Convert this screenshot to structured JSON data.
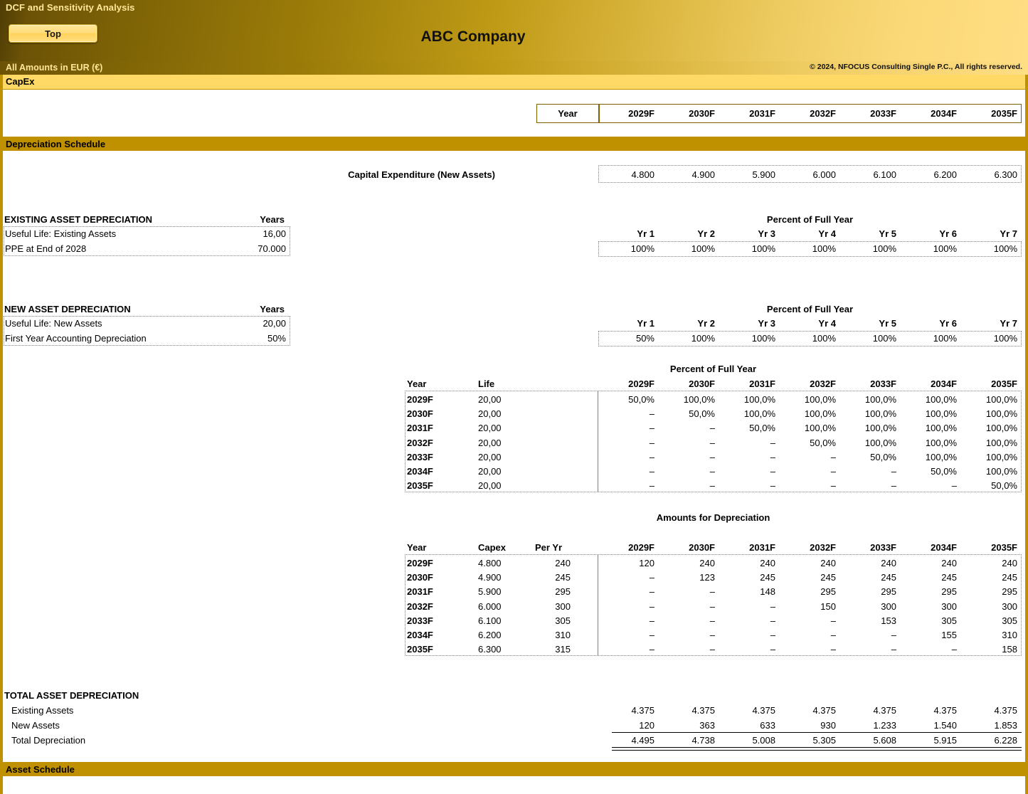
{
  "banner": {
    "title": "DCF and Sensitivity Analysis",
    "top_button": "Top",
    "company": "ABC Company",
    "amounts": "All Amounts in  EUR (€)",
    "copyright": "© 2024, NFOCUS Consulting Single P.C., All rights reserved."
  },
  "sheet_tab": "CapEx",
  "sections": {
    "depreciation_schedule": "Depreciation Schedule",
    "asset_schedule": "Asset Schedule"
  },
  "year_header": {
    "label": "Year",
    "years": [
      "2029F",
      "2030F",
      "2031F",
      "2032F",
      "2033F",
      "2034F",
      "2035F"
    ]
  },
  "capex_row": {
    "label": "Capital Expenditure  (New Assets)",
    "values": [
      "4.800",
      "4.900",
      "5.900",
      "6.000",
      "6.100",
      "6.200",
      "6.300"
    ]
  },
  "existing_asset": {
    "title": "EXISTING ASSET DEPRECIATION",
    "years_header": "Years",
    "rows": [
      {
        "label": "Useful Life: Existing Assets",
        "value": "16,00"
      },
      {
        "label": "PPE at End of 2028",
        "value": "70.000"
      }
    ],
    "percent_title": "Percent of Full Year",
    "yr_headers": [
      "Yr 1",
      "Yr 2",
      "Yr 3",
      "Yr 4",
      "Yr 5",
      "Yr 6",
      "Yr 7"
    ],
    "percents": [
      "100%",
      "100%",
      "100%",
      "100%",
      "100%",
      "100%",
      "100%"
    ]
  },
  "new_asset": {
    "title": "NEW ASSET DEPRECIATION",
    "years_header": "Years",
    "rows": [
      {
        "label": "Useful Life: New Assets",
        "value": "20,00"
      },
      {
        "label": "First Year Accounting Depreciation",
        "value": "50%"
      }
    ],
    "percent_title": "Percent of Full Year",
    "yr_headers": [
      "Yr 1",
      "Yr 2",
      "Yr 3",
      "Yr 4",
      "Yr 5",
      "Yr 6",
      "Yr 7"
    ],
    "percents": [
      "50%",
      "100%",
      "100%",
      "100%",
      "100%",
      "100%",
      "100%"
    ]
  },
  "percent_matrix": {
    "title": "Percent of Full Year",
    "col_year": "Year",
    "col_life": "Life",
    "year_cols": [
      "2029F",
      "2030F",
      "2031F",
      "2032F",
      "2033F",
      "2034F",
      "2035F"
    ],
    "rows": [
      {
        "year": "2029F",
        "life": "20,00",
        "values": [
          "50,0%",
          "100,0%",
          "100,0%",
          "100,0%",
          "100,0%",
          "100,0%",
          "100,0%"
        ]
      },
      {
        "year": "2030F",
        "life": "20,00",
        "values": [
          "–",
          "50,0%",
          "100,0%",
          "100,0%",
          "100,0%",
          "100,0%",
          "100,0%"
        ]
      },
      {
        "year": "2031F",
        "life": "20,00",
        "values": [
          "–",
          "–",
          "50,0%",
          "100,0%",
          "100,0%",
          "100,0%",
          "100,0%"
        ]
      },
      {
        "year": "2032F",
        "life": "20,00",
        "values": [
          "–",
          "–",
          "–",
          "50,0%",
          "100,0%",
          "100,0%",
          "100,0%"
        ]
      },
      {
        "year": "2033F",
        "life": "20,00",
        "values": [
          "–",
          "–",
          "–",
          "–",
          "50,0%",
          "100,0%",
          "100,0%"
        ]
      },
      {
        "year": "2034F",
        "life": "20,00",
        "values": [
          "–",
          "–",
          "–",
          "–",
          "–",
          "50,0%",
          "100,0%"
        ]
      },
      {
        "year": "2035F",
        "life": "20,00",
        "values": [
          "–",
          "–",
          "–",
          "–",
          "–",
          "–",
          "50,0%"
        ]
      }
    ]
  },
  "amounts_matrix": {
    "title": "Amounts for Depreciation",
    "col_year": "Year",
    "col_capex": "Capex",
    "col_peryr": "Per Yr",
    "year_cols": [
      "2029F",
      "2030F",
      "2031F",
      "2032F",
      "2033F",
      "2034F",
      "2035F"
    ],
    "rows": [
      {
        "year": "2029F",
        "capex": "4.800",
        "per_yr": "240",
        "values": [
          "120",
          "240",
          "240",
          "240",
          "240",
          "240",
          "240"
        ]
      },
      {
        "year": "2030F",
        "capex": "4.900",
        "per_yr": "245",
        "values": [
          "–",
          "123",
          "245",
          "245",
          "245",
          "245",
          "245"
        ]
      },
      {
        "year": "2031F",
        "capex": "5.900",
        "per_yr": "295",
        "values": [
          "–",
          "–",
          "148",
          "295",
          "295",
          "295",
          "295"
        ]
      },
      {
        "year": "2032F",
        "capex": "6.000",
        "per_yr": "300",
        "values": [
          "–",
          "–",
          "–",
          "150",
          "300",
          "300",
          "300"
        ]
      },
      {
        "year": "2033F",
        "capex": "6.100",
        "per_yr": "305",
        "values": [
          "–",
          "–",
          "–",
          "–",
          "153",
          "305",
          "305"
        ]
      },
      {
        "year": "2034F",
        "capex": "6.200",
        "per_yr": "310",
        "values": [
          "–",
          "–",
          "–",
          "–",
          "–",
          "155",
          "310"
        ]
      },
      {
        "year": "2035F",
        "capex": "6.300",
        "per_yr": "315",
        "values": [
          "–",
          "–",
          "–",
          "–",
          "–",
          "–",
          "158"
        ]
      }
    ]
  },
  "totals": {
    "title": "TOTAL ASSET DEPRECIATION",
    "rows": [
      {
        "label": "Existing Assets",
        "values": [
          "4.375",
          "4.375",
          "4.375",
          "4.375",
          "4.375",
          "4.375",
          "4.375"
        ]
      },
      {
        "label": "New Assets",
        "values": [
          "120",
          "363",
          "633",
          "930",
          "1.233",
          "1.540",
          "1.853"
        ]
      },
      {
        "label": "Total Depreciation",
        "values": [
          "4.495",
          "4.738",
          "5.008",
          "5.305",
          "5.608",
          "5.915",
          "6.228"
        ]
      }
    ]
  },
  "colors": {
    "bar_gold": "#BF9000",
    "tab_yellow": "#FFD966",
    "banner_text": "#FFE699"
  }
}
